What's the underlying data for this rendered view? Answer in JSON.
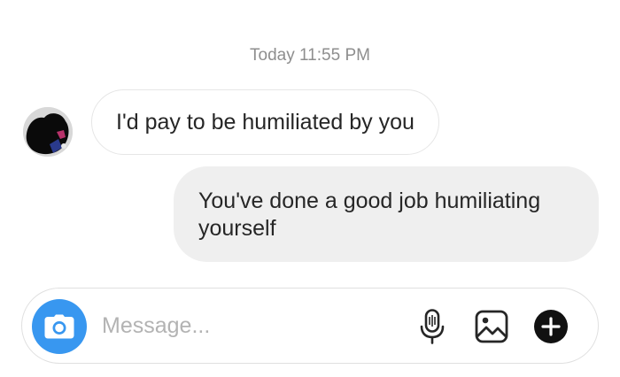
{
  "thread": {
    "timestamp": "Today 11:55 PM",
    "messages": [
      {
        "sender": "them",
        "text": "I'd pay to be humiliated by you"
      },
      {
        "sender": "me",
        "text": "You've done a good job humiliating yourself"
      }
    ]
  },
  "composer": {
    "placeholder": "Message...",
    "value": "",
    "accent_color": "#3897f0",
    "icons": [
      "camera-icon",
      "microphone-icon",
      "image-icon",
      "plus-icon"
    ]
  }
}
